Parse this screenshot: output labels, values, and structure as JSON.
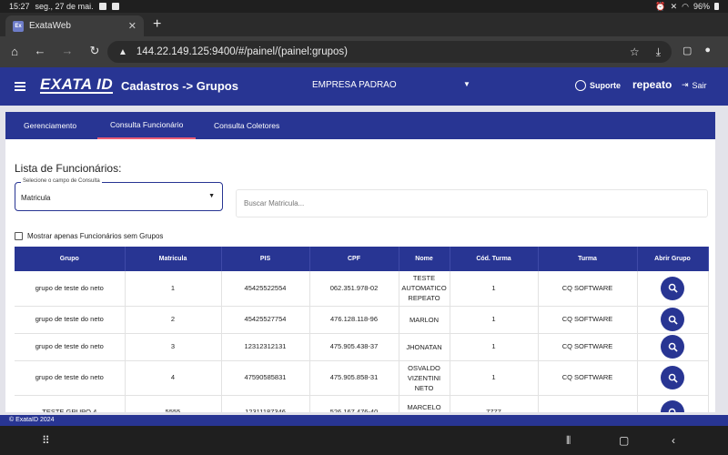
{
  "status": {
    "time": "15:27",
    "date": "seg., 27 de mai.",
    "battery": "96%"
  },
  "browser": {
    "tab_title": "ExataWeb",
    "favicon_text": "Ex",
    "url": "144.22.149.125:9400/#/painel/(painel:grupos)"
  },
  "app": {
    "logo": "EXATA ID",
    "title": "Cadastros -> Grupos",
    "company": "EMPRESA PADRAO",
    "support_label": "Suporte",
    "user": "repeato",
    "logout_label": "Sair",
    "accent": "#283593"
  },
  "tabs": [
    "Gerenciamento",
    "Consulta Funcionário",
    "Consulta Coletores"
  ],
  "active_tab": 1,
  "page": {
    "heading": "Lista de Funcionários:",
    "select_label": "Selecione o campo de Consulta",
    "select_value": "Matricula",
    "search_placeholder": "Buscar Matricula...",
    "checkbox_label": "Mostrar apenas Funcionários sem Grupos"
  },
  "table": {
    "headers": [
      "Grupo",
      "Matricula",
      "PIS",
      "CPF",
      "Nome",
      "Cód. Turma",
      "Turma",
      "Abrir Grupo"
    ],
    "rows": [
      {
        "grupo": "grupo de teste do neto",
        "matricula": "1",
        "pis": "45425522554",
        "cpf": "062.351.978-02",
        "nome": "TESTE AUTOMATICO REPEATO",
        "cod": "1",
        "turma": "CQ SOFTWARE"
      },
      {
        "grupo": "grupo de teste do neto",
        "matricula": "2",
        "pis": "45425527754",
        "cpf": "476.128.118-96",
        "nome": "MARLON",
        "cod": "1",
        "turma": "CQ SOFTWARE"
      },
      {
        "grupo": "grupo de teste do neto",
        "matricula": "3",
        "pis": "12312312131",
        "cpf": "475.905.438-37",
        "nome": "JHONATAN",
        "cod": "1",
        "turma": "CQ SOFTWARE"
      },
      {
        "grupo": "grupo de teste do neto",
        "matricula": "4",
        "pis": "47590585831",
        "cpf": "475.905.858-31",
        "nome": "OSVALDO VIZENTINI NETO",
        "cod": "1",
        "turma": "CQ SOFTWARE"
      },
      {
        "grupo": "TESTE GRUPO 4",
        "matricula": "5555",
        "pis": "12311187346",
        "cpf": "526.167.476-40",
        "nome": "MARCELO VINICIUS",
        "cod": "7777",
        "turma": ""
      }
    ]
  },
  "footer": "© ExataID 2024"
}
